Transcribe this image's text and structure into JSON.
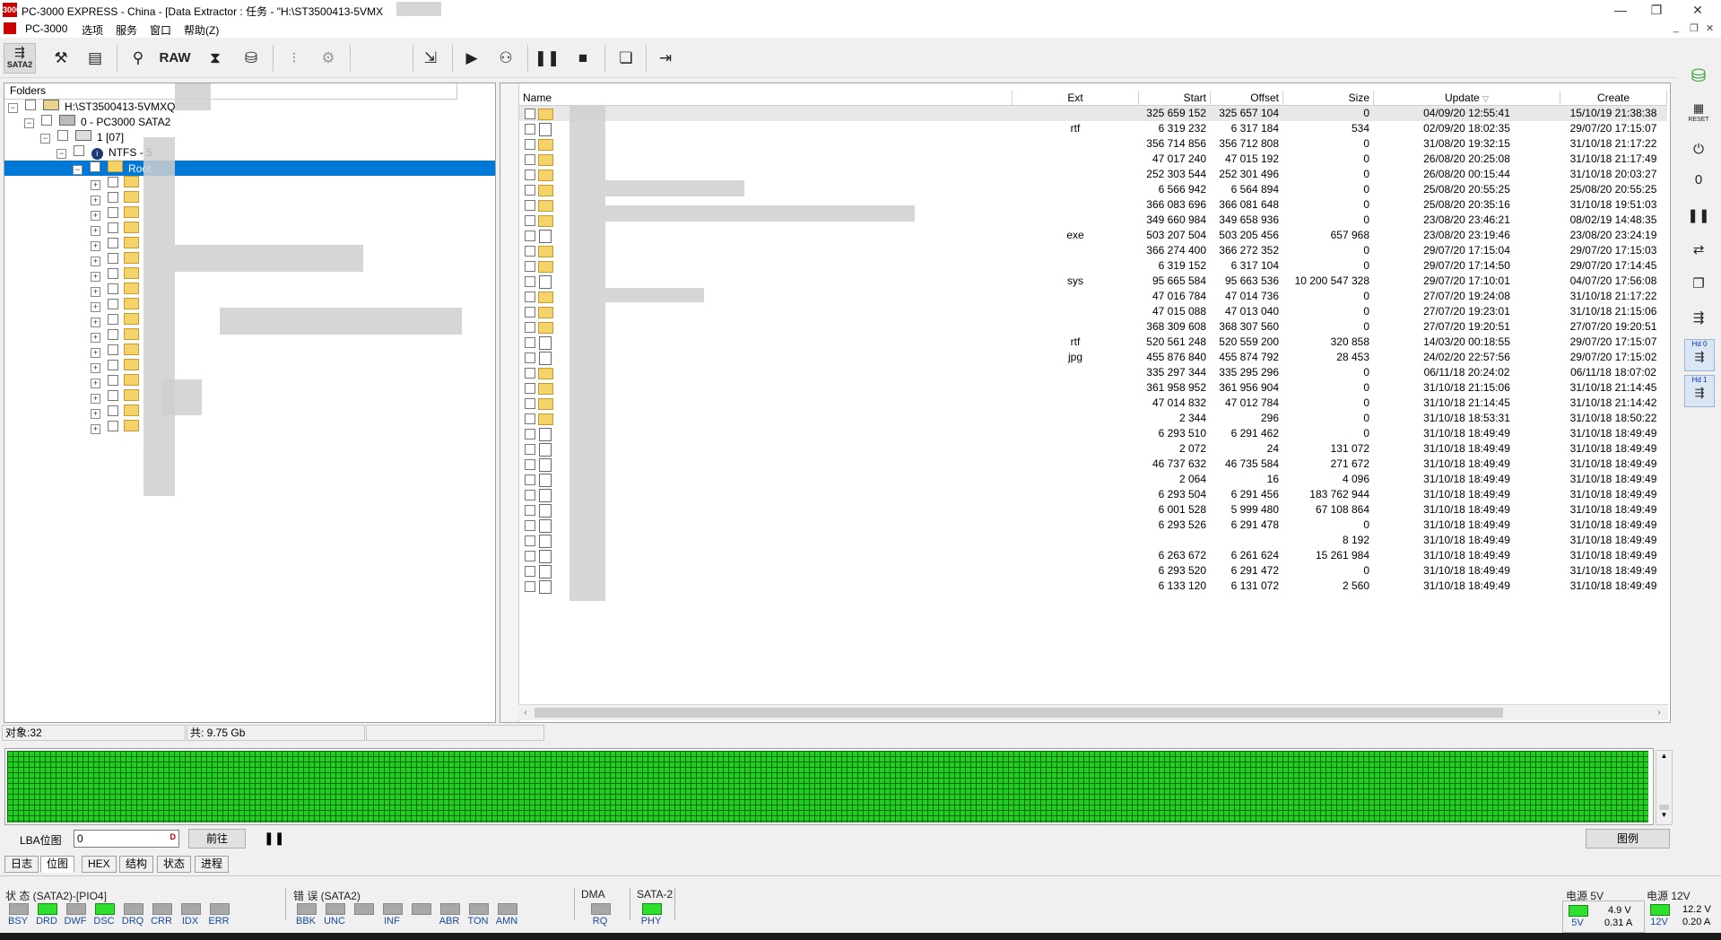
{
  "window": {
    "app_icon_text": "3000",
    "title": "PC-3000 EXPRESS - China - [Data Extractor : 任务 - \"H:\\ST3500413-5VMX",
    "controls": [
      "—",
      "❐",
      "✕"
    ]
  },
  "menu": {
    "items": [
      "PC-3000",
      "选项",
      "服务",
      "窗口",
      "帮助(Z)"
    ],
    "mdi_controls": [
      "_",
      "❐",
      "✕"
    ]
  },
  "toolbar": {
    "sata_label": "SATA2",
    "raw_label": "RAW"
  },
  "tree": {
    "header": "Folders",
    "nodes": [
      {
        "label": "H:\\ST3500413-5VMXQ"
      },
      {
        "label": "0 - PC3000 SATA2"
      },
      {
        "label": "1 [07]"
      },
      {
        "label": "NTFS - 5"
      },
      {
        "label": "Root"
      }
    ],
    "folder_count": 17
  },
  "table": {
    "columns": [
      "Name",
      "Ext",
      "Start",
      "Offset",
      "Size",
      "Update",
      "Create"
    ],
    "rows": [
      {
        "ext": "",
        "start": "325 659 152",
        "offset": "325 657 104",
        "size": "0",
        "update": "04/09/20 12:55:41",
        "create": "15/10/19 21:38:38"
      },
      {
        "ext": "rtf",
        "start": "6 319 232",
        "offset": "6 317 184",
        "size": "534",
        "update": "02/09/20 18:02:35",
        "create": "29/07/20 17:15:07"
      },
      {
        "ext": "",
        "start": "356 714 856",
        "offset": "356 712 808",
        "size": "0",
        "update": "31/08/20 19:32:15",
        "create": "31/10/18 21:17:22"
      },
      {
        "ext": "",
        "start": "47 017 240",
        "offset": "47 015 192",
        "size": "0",
        "update": "26/08/20 20:25:08",
        "create": "31/10/18 21:17:49"
      },
      {
        "ext": "",
        "start": "252 303 544",
        "offset": "252 301 496",
        "size": "0",
        "update": "26/08/20 00:15:44",
        "create": "31/10/18 20:03:27"
      },
      {
        "ext": "",
        "start": "6 566 942",
        "offset": "6 564 894",
        "size": "0",
        "update": "25/08/20 20:55:25",
        "create": "25/08/20 20:55:25"
      },
      {
        "ext": "",
        "start": "366 083 696",
        "offset": "366 081 648",
        "size": "0",
        "update": "25/08/20 20:35:16",
        "create": "31/10/18 19:51:03"
      },
      {
        "ext": "",
        "start": "349 660 984",
        "offset": "349 658 936",
        "size": "0",
        "update": "23/08/20 23:46:21",
        "create": "08/02/19 14:48:35"
      },
      {
        "ext": "exe",
        "start": "503 207 504",
        "offset": "503 205 456",
        "size": "657 968",
        "update": "23/08/20 23:19:46",
        "create": "23/08/20 23:24:19"
      },
      {
        "ext": "",
        "start": "366 274 400",
        "offset": "366 272 352",
        "size": "0",
        "update": "29/07/20 17:15:04",
        "create": "29/07/20 17:15:03"
      },
      {
        "ext": "",
        "start": "6 319 152",
        "offset": "6 317 104",
        "size": "0",
        "update": "29/07/20 17:14:50",
        "create": "29/07/20 17:14:45"
      },
      {
        "ext": "sys",
        "start": "95 665 584",
        "offset": "95 663 536",
        "size": "10 200 547 328",
        "update": "29/07/20 17:10:01",
        "create": "04/07/20 17:56:08"
      },
      {
        "ext": "",
        "start": "47 016 784",
        "offset": "47 014 736",
        "size": "0",
        "update": "27/07/20 19:24:08",
        "create": "31/10/18 21:17:22"
      },
      {
        "ext": "",
        "start": "47 015 088",
        "offset": "47 013 040",
        "size": "0",
        "update": "27/07/20 19:23:01",
        "create": "31/10/18 21:15:06"
      },
      {
        "ext": "",
        "start": "368 309 608",
        "offset": "368 307 560",
        "size": "0",
        "update": "27/07/20 19:20:51",
        "create": "27/07/20 19:20:51"
      },
      {
        "ext": "rtf",
        "start": "520 561 248",
        "offset": "520 559 200",
        "size": "320 858",
        "update": "14/03/20 00:18:55",
        "create": "29/07/20 17:15:07"
      },
      {
        "ext": "jpg",
        "start": "455 876 840",
        "offset": "455 874 792",
        "size": "28 453",
        "update": "24/02/20 22:57:56",
        "create": "29/07/20 17:15:02"
      },
      {
        "ext": "",
        "start": "335 297 344",
        "offset": "335 295 296",
        "size": "0",
        "update": "06/11/18 20:24:02",
        "create": "06/11/18 18:07:02"
      },
      {
        "ext": "",
        "start": "361 958 952",
        "offset": "361 956 904",
        "size": "0",
        "update": "31/10/18 21:15:06",
        "create": "31/10/18 21:14:45"
      },
      {
        "ext": "",
        "start": "47 014 832",
        "offset": "47 012 784",
        "size": "0",
        "update": "31/10/18 21:14:45",
        "create": "31/10/18 21:14:42"
      },
      {
        "ext": "",
        "start": "2 344",
        "offset": "296",
        "size": "0",
        "update": "31/10/18 18:53:31",
        "create": "31/10/18 18:50:22"
      },
      {
        "ext": "",
        "start": "6 293 510",
        "offset": "6 291 462",
        "size": "0",
        "update": "31/10/18 18:49:49",
        "create": "31/10/18 18:49:49"
      },
      {
        "ext": "",
        "start": "2 072",
        "offset": "24",
        "size": "131 072",
        "update": "31/10/18 18:49:49",
        "create": "31/10/18 18:49:49"
      },
      {
        "ext": "",
        "start": "46 737 632",
        "offset": "46 735 584",
        "size": "271 672",
        "update": "31/10/18 18:49:49",
        "create": "31/10/18 18:49:49"
      },
      {
        "ext": "",
        "start": "2 064",
        "offset": "16",
        "size": "4 096",
        "update": "31/10/18 18:49:49",
        "create": "31/10/18 18:49:49"
      },
      {
        "ext": "",
        "start": "6 293 504",
        "offset": "6 291 456",
        "size": "183 762 944",
        "update": "31/10/18 18:49:49",
        "create": "31/10/18 18:49:49"
      },
      {
        "ext": "",
        "start": "6 001 528",
        "offset": "5 999 480",
        "size": "67 108 864",
        "update": "31/10/18 18:49:49",
        "create": "31/10/18 18:49:49"
      },
      {
        "ext": "",
        "start": "6 293 526",
        "offset": "6 291 478",
        "size": "0",
        "update": "31/10/18 18:49:49",
        "create": "31/10/18 18:49:49"
      },
      {
        "ext": "",
        "start": "",
        "offset": "",
        "size": "8 192",
        "update": "31/10/18 18:49:49",
        "create": "31/10/18 18:49:49"
      },
      {
        "ext": "",
        "start": "6 263 672",
        "offset": "6 261 624",
        "size": "15 261 984",
        "update": "31/10/18 18:49:49",
        "create": "31/10/18 18:49:49"
      },
      {
        "ext": "",
        "start": "6 293 520",
        "offset": "6 291 472",
        "size": "0",
        "update": "31/10/18 18:49:49",
        "create": "31/10/18 18:49:49"
      },
      {
        "ext": "",
        "start": "6 133 120",
        "offset": "6 131 072",
        "size": "2 560",
        "update": "31/10/18 18:49:49",
        "create": "31/10/18 18:49:49"
      }
    ]
  },
  "status": {
    "objects": "对象:32",
    "total": "共: 9.75 Gb"
  },
  "lba": {
    "label": "LBA位图",
    "value": "0",
    "goto": "前往",
    "legend": "图例"
  },
  "tabs": [
    "日志",
    "位图",
    "HEX",
    "结构",
    "状态",
    "进程"
  ],
  "indicators": {
    "status_title": "状 态 (SATA2)-[PIO4]",
    "status": [
      {
        "label": "BSY",
        "on": false
      },
      {
        "label": "DRD",
        "on": true
      },
      {
        "label": "DWF",
        "on": false
      },
      {
        "label": "DSC",
        "on": true
      },
      {
        "label": "DRQ",
        "on": false
      },
      {
        "label": "CRR",
        "on": false
      },
      {
        "label": "IDX",
        "on": false
      },
      {
        "label": "ERR",
        "on": false
      }
    ],
    "error_title": "错 误 (SATA2)",
    "errors": [
      {
        "label": "BBK",
        "on": false
      },
      {
        "label": "UNC",
        "on": false
      },
      {
        "label": "",
        "on": false
      },
      {
        "label": "INF",
        "on": false
      },
      {
        "label": "",
        "on": false
      },
      {
        "label": "ABR",
        "on": false
      },
      {
        "label": "TON",
        "on": false
      },
      {
        "label": "AMN",
        "on": false
      }
    ],
    "dma_title": "DMA",
    "dma": [
      {
        "label": "RQ",
        "on": false
      }
    ],
    "sata_title": "SATA-2",
    "sata": [
      {
        "label": "PHY",
        "on": true
      }
    ],
    "power5_title": "电源 5V",
    "power5_label": "5V",
    "power5_volt": "4.9 V",
    "power5_amp": "0.31 A",
    "power12_title": "电源 12V",
    "power12_label": "12V",
    "power12_volt": "12.2 V",
    "power12_amp": "0.20 A"
  },
  "right_toolbar": {
    "reset_label": "RESET",
    "hd0_label": "Hd 0",
    "hd1_label": "Hd 1"
  }
}
